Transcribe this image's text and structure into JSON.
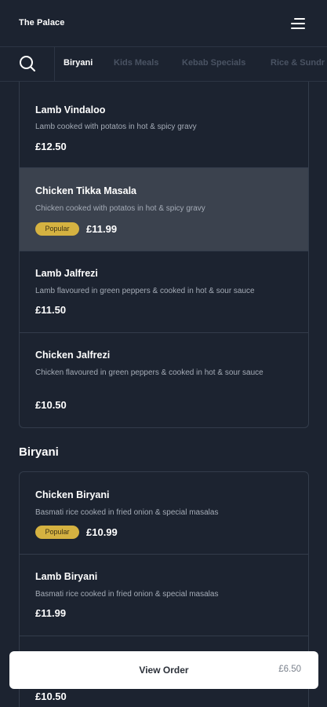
{
  "header": {
    "title": "The Palace"
  },
  "categories": [
    "Biryani",
    "Kids Meals",
    "Kebab Specials",
    "Rice & Sundr"
  ],
  "active_category": "Biryani",
  "top_list": [
    {
      "name": "Lamb Vindaloo",
      "desc": "Lamb cooked with potatos in hot & spicy gravy",
      "price": "£12.50",
      "badge": ""
    },
    {
      "name": "Chicken Tikka Masala",
      "desc": "Chicken cooked with potatos in hot & spicy gravy",
      "price": "£11.99",
      "badge": "Popular"
    },
    {
      "name": "Lamb Jalfrezi",
      "desc": "Lamb flavoured in green peppers & cooked in hot & sour sauce",
      "price": "£11.50",
      "badge": ""
    },
    {
      "name": "Chicken Jalfrezi",
      "desc": "Chicken flavoured in green peppers & cooked in hot & sour sauce",
      "price": "£10.50",
      "badge": ""
    }
  ],
  "biryani_section": {
    "title": "Biryani",
    "items": [
      {
        "name": "Chicken Biryani",
        "desc": "Basmati rice cooked in fried onion & special masalas",
        "price": "£10.99",
        "badge": "Popular"
      },
      {
        "name": "Lamb Biryani",
        "desc": "Basmati rice cooked in fried onion & special masalas",
        "price": "£11.99",
        "badge": ""
      },
      {
        "name": "",
        "desc": "",
        "price": "£10.50",
        "badge": ""
      }
    ]
  },
  "order": {
    "label": "View Order",
    "total": "£6.50"
  },
  "colors": {
    "background": "#1c2330",
    "highlight": "#3b424e",
    "badge": "#d5b241",
    "muted_text": "#a4abb6"
  },
  "icons": {
    "menu": "hamburger-menu-icon",
    "search": "search-icon"
  }
}
